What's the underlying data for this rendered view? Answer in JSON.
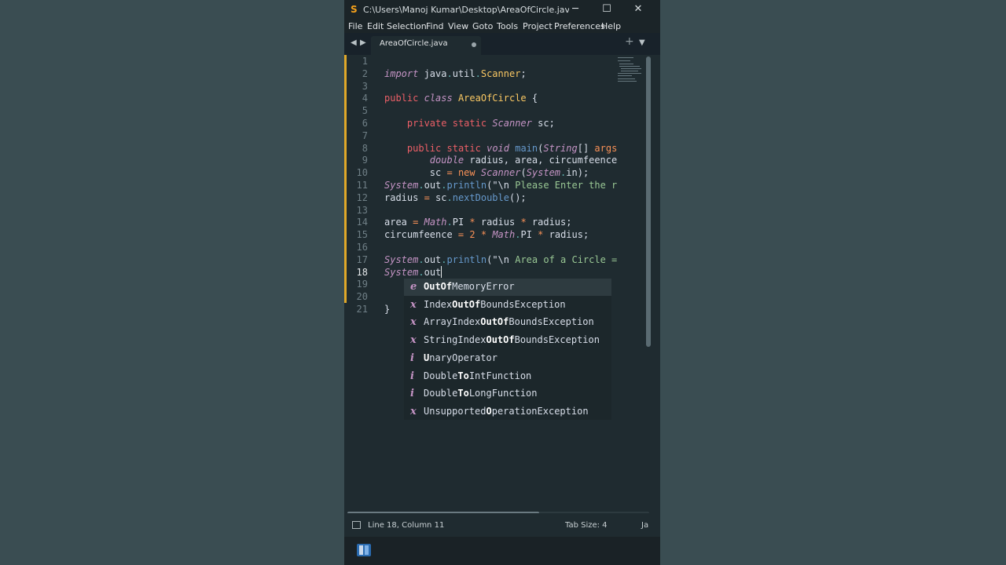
{
  "window": {
    "title": "C:\\Users\\Manoj Kumar\\Desktop\\AreaOfCircle.java • - Su...",
    "minimize_glyph": "─",
    "maximize_glyph": "☐",
    "close_glyph": "✕"
  },
  "menu": [
    "File",
    "Edit",
    "Selection",
    "Find",
    "View",
    "Goto",
    "Tools",
    "Project",
    "Preferences",
    "Help"
  ],
  "tabs": [
    {
      "label": "AreaOfCircle.java",
      "modified": true
    }
  ],
  "tabbar": {
    "new_tab": "+",
    "dropdown": "▼",
    "prev": "◀",
    "next": "▶"
  },
  "editor": {
    "line_numbers": [
      "1",
      "2",
      "3",
      "4",
      "5",
      "6",
      "7",
      "8",
      "9",
      "10",
      "11",
      "12",
      "13",
      "14",
      "15",
      "16",
      "17",
      "18",
      "19",
      "20",
      "21"
    ],
    "active_line": "18",
    "lines": [
      [],
      [
        {
          "t": "import",
          "c": "t-kw"
        },
        {
          "t": " java",
          "c": "t-plain"
        },
        {
          "t": ".",
          "c": "t-dot"
        },
        {
          "t": "util",
          "c": "t-plain"
        },
        {
          "t": ".",
          "c": "t-dot"
        },
        {
          "t": "Scanner",
          "c": "t-cls"
        },
        {
          "t": ";",
          "c": "t-plain"
        }
      ],
      [],
      [
        {
          "t": "public",
          "c": "t-mod"
        },
        {
          "t": " ",
          "c": "t-plain"
        },
        {
          "t": "class",
          "c": "t-kw"
        },
        {
          "t": " ",
          "c": "t-plain"
        },
        {
          "t": "AreaOfCircle",
          "c": "t-cls"
        },
        {
          "t": " {",
          "c": "t-plain"
        }
      ],
      [],
      [
        {
          "t": "    ",
          "c": "t-plain"
        },
        {
          "t": "private",
          "c": "t-mod"
        },
        {
          "t": " ",
          "c": "t-plain"
        },
        {
          "t": "static",
          "c": "t-mod"
        },
        {
          "t": " ",
          "c": "t-plain"
        },
        {
          "t": "Scanner",
          "c": "t-type"
        },
        {
          "t": " sc;",
          "c": "t-plain"
        }
      ],
      [],
      [
        {
          "t": "    ",
          "c": "t-plain"
        },
        {
          "t": "public",
          "c": "t-mod"
        },
        {
          "t": " ",
          "c": "t-plain"
        },
        {
          "t": "static",
          "c": "t-mod"
        },
        {
          "t": " ",
          "c": "t-plain"
        },
        {
          "t": "void",
          "c": "t-kw"
        },
        {
          "t": " ",
          "c": "t-plain"
        },
        {
          "t": "main",
          "c": "t-fn"
        },
        {
          "t": "(",
          "c": "t-plain"
        },
        {
          "t": "String",
          "c": "t-type"
        },
        {
          "t": "[] ",
          "c": "t-plain"
        },
        {
          "t": "args",
          "c": "t-op"
        }
      ],
      [
        {
          "t": "        ",
          "c": "t-plain"
        },
        {
          "t": "double",
          "c": "t-kw"
        },
        {
          "t": " radius, area, circumfeence",
          "c": "t-plain"
        }
      ],
      [
        {
          "t": "        sc ",
          "c": "t-plain"
        },
        {
          "t": "=",
          "c": "t-op"
        },
        {
          "t": " ",
          "c": "t-plain"
        },
        {
          "t": "new",
          "c": "t-op"
        },
        {
          "t": " ",
          "c": "t-plain"
        },
        {
          "t": "Scanner",
          "c": "t-type"
        },
        {
          "t": "(",
          "c": "t-plain"
        },
        {
          "t": "System",
          "c": "t-sysc"
        },
        {
          "t": ".",
          "c": "t-dot"
        },
        {
          "t": "in",
          "c": "t-plain"
        },
        {
          "t": ");",
          "c": "t-plain"
        }
      ],
      [
        {
          "t": "System",
          "c": "t-sysc"
        },
        {
          "t": ".",
          "c": "t-dot"
        },
        {
          "t": "out",
          "c": "t-plain"
        },
        {
          "t": ".",
          "c": "t-dot"
        },
        {
          "t": "println",
          "c": "t-fn"
        },
        {
          "t": "(\"",
          "c": "t-plain"
        },
        {
          "t": "\\n",
          "c": "t-plain"
        },
        {
          "t": " Please Enter the r",
          "c": "t-str"
        }
      ],
      [
        {
          "t": "radius ",
          "c": "t-plain"
        },
        {
          "t": "=",
          "c": "t-op"
        },
        {
          "t": " sc",
          "c": "t-plain"
        },
        {
          "t": ".",
          "c": "t-dot"
        },
        {
          "t": "nextDouble",
          "c": "t-fn"
        },
        {
          "t": "();",
          "c": "t-plain"
        }
      ],
      [],
      [
        {
          "t": "area ",
          "c": "t-plain"
        },
        {
          "t": "=",
          "c": "t-op"
        },
        {
          "t": " ",
          "c": "t-plain"
        },
        {
          "t": "Math",
          "c": "t-sysc"
        },
        {
          "t": ".",
          "c": "t-dot"
        },
        {
          "t": "PI",
          "c": "t-plain"
        },
        {
          "t": " ",
          "c": "t-plain"
        },
        {
          "t": "*",
          "c": "t-op"
        },
        {
          "t": " radius ",
          "c": "t-plain"
        },
        {
          "t": "*",
          "c": "t-op"
        },
        {
          "t": " radius;",
          "c": "t-plain"
        }
      ],
      [
        {
          "t": "circumfeence ",
          "c": "t-plain"
        },
        {
          "t": "=",
          "c": "t-op"
        },
        {
          "t": " ",
          "c": "t-plain"
        },
        {
          "t": "2",
          "c": "t-num"
        },
        {
          "t": " ",
          "c": "t-plain"
        },
        {
          "t": "*",
          "c": "t-op"
        },
        {
          "t": " ",
          "c": "t-plain"
        },
        {
          "t": "Math",
          "c": "t-sysc"
        },
        {
          "t": ".",
          "c": "t-dot"
        },
        {
          "t": "PI",
          "c": "t-plain"
        },
        {
          "t": " ",
          "c": "t-plain"
        },
        {
          "t": "*",
          "c": "t-op"
        },
        {
          "t": " radius;",
          "c": "t-plain"
        }
      ],
      [],
      [
        {
          "t": "System",
          "c": "t-sysc"
        },
        {
          "t": ".",
          "c": "t-dot"
        },
        {
          "t": "out",
          "c": "t-plain"
        },
        {
          "t": ".",
          "c": "t-dot"
        },
        {
          "t": "println",
          "c": "t-fn"
        },
        {
          "t": "(\"",
          "c": "t-plain"
        },
        {
          "t": "\\n",
          "c": "t-plain"
        },
        {
          "t": " Area of a Circle =",
          "c": "t-str"
        }
      ],
      [
        {
          "t": "System",
          "c": "t-sysc"
        },
        {
          "t": ".",
          "c": "t-dot"
        },
        {
          "t": "out",
          "c": "t-plain"
        }
      ],
      [],
      [],
      [
        {
          "t": "}",
          "c": "t-plain"
        }
      ]
    ]
  },
  "autocomplete": [
    {
      "icon": "e",
      "color": "#c594c5",
      "match": "OutOf",
      "rest": "MemoryError",
      "prefix": "",
      "selected": true
    },
    {
      "icon": "x",
      "color": "#c594c5",
      "prefix": "Index",
      "match": "OutOf",
      "rest": "BoundsException"
    },
    {
      "icon": "x",
      "color": "#c594c5",
      "prefix": "ArrayIndex",
      "match": "OutOf",
      "rest": "BoundsException"
    },
    {
      "icon": "x",
      "color": "#c594c5",
      "prefix": "StringIndex",
      "match": "OutOf",
      "rest": "BoundsException"
    },
    {
      "icon": "i",
      "color": "#c594c5",
      "prefix": "",
      "match": "U",
      "rest": "naryOperator"
    },
    {
      "icon": "i",
      "color": "#c594c5",
      "prefix": "Double",
      "match": "To",
      "rest": "IntFunction"
    },
    {
      "icon": "i",
      "color": "#c594c5",
      "prefix": "Double",
      "match": "To",
      "rest": "LongFunction"
    },
    {
      "icon": "x",
      "color": "#c594c5",
      "prefix": "Unsupported",
      "match": "O",
      "rest": "perationException"
    }
  ],
  "status": {
    "position": "Line 18, Column 11",
    "tab_size": "Tab Size: 4",
    "syntax": "Ja"
  },
  "colors": {
    "accent_modified": "#e0a829",
    "editor_bg": "#1f2b30",
    "desktop_bg": "#3a4d52"
  }
}
